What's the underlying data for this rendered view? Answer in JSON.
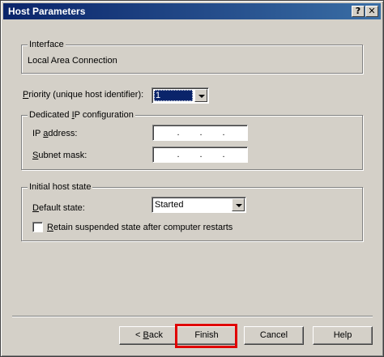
{
  "window": {
    "title": "Host Parameters",
    "help_glyph": "?",
    "close_glyph": "✕"
  },
  "interface": {
    "legend": "Interface",
    "value": "Local Area Connection"
  },
  "priority": {
    "label_accel": "P",
    "label_rest": "riority (unique host identifier):",
    "selected": "1"
  },
  "dedicated_ip": {
    "legend_pre": "Dedicated ",
    "legend_accel": "I",
    "legend_post": "P configuration",
    "ip_label_pre": "IP ",
    "ip_label_accel": "a",
    "ip_label_post": "ddress:",
    "subnet_label_accel": "S",
    "subnet_label_post": "ubnet mask:",
    "ip_value": "",
    "subnet_value": "",
    "dot": "."
  },
  "initial_state": {
    "legend": "Initial host state",
    "default_label_accel": "D",
    "default_label_post": "efault state:",
    "default_value": "Started",
    "retain_accel": "R",
    "retain_post": "etain suspended state after computer restarts",
    "retain_checked": false
  },
  "buttons": {
    "back_pre": "< ",
    "back_accel": "B",
    "back_post": "ack",
    "finish": "Finish",
    "cancel": "Cancel",
    "help": "Help"
  },
  "colors": {
    "titlebar": "#0a246a",
    "highlight": "#e00000",
    "dialog_bg": "#d4d0c8"
  }
}
